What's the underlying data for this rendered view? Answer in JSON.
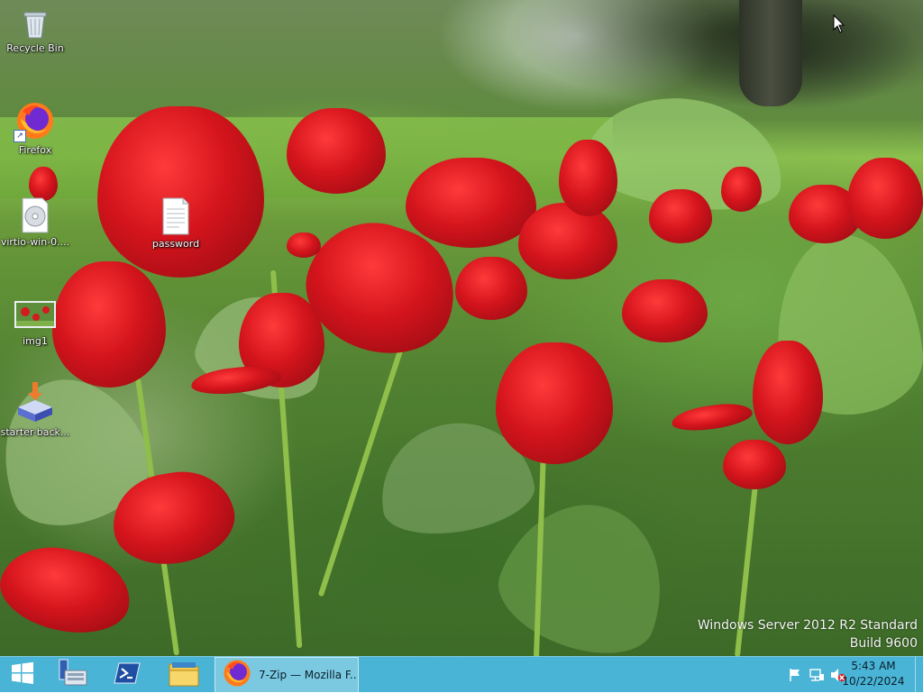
{
  "desktop": {
    "icons": [
      {
        "id": "recycle-bin",
        "label": "Recycle Bin",
        "icon": "recycle-bin-icon"
      },
      {
        "id": "firefox",
        "label": "Firefox",
        "icon": "firefox-icon",
        "shortcut": true
      },
      {
        "id": "virtio",
        "label": "virtio-win-0....",
        "icon": "disc-image-icon"
      },
      {
        "id": "password",
        "label": "password",
        "icon": "text-file-icon"
      },
      {
        "id": "img1",
        "label": "img1",
        "icon": "image-file-icon"
      },
      {
        "id": "starter-back",
        "label": "starter-back...",
        "icon": "installer-package-icon"
      }
    ]
  },
  "watermark": {
    "line1": "Windows Server 2012 R2 Standard",
    "line2": "Build 9600"
  },
  "taskbar": {
    "start_icon": "windows-logo-icon",
    "pinned": [
      {
        "name": "server-manager",
        "icon": "server-manager-icon"
      },
      {
        "name": "powershell",
        "icon": "powershell-icon"
      },
      {
        "name": "file-explorer",
        "icon": "file-explorer-icon"
      }
    ],
    "active_app": {
      "label": "7-Zip — Mozilla F...",
      "icon": "firefox-icon"
    },
    "tray_icons": [
      "action-center-flag-icon",
      "network-icon",
      "volume-muted-icon"
    ],
    "clock": {
      "time": "5:43 AM",
      "date": "10/22/2024"
    }
  },
  "colors": {
    "taskbar": "#49b4d6",
    "accent_red": "#d4141c"
  }
}
